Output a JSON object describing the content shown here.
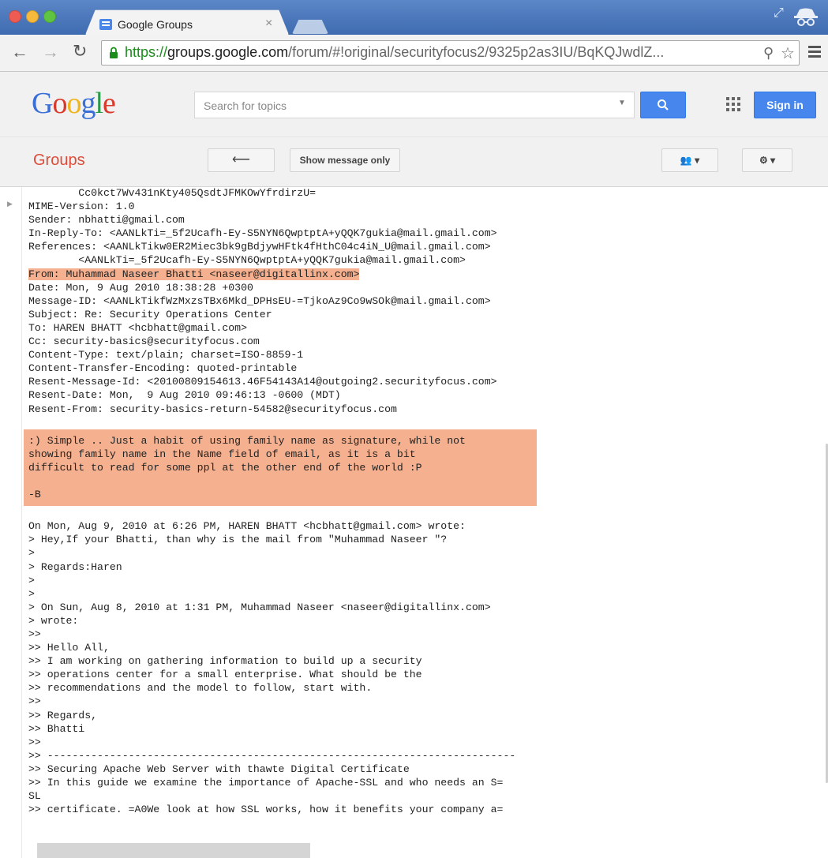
{
  "browser": {
    "tab_title": "Google Groups",
    "tab_close": "×",
    "url_scheme": "https://",
    "url_host": "groups.google.com",
    "url_path": "/forum/#!original/securityfocus2/9325p2as3IU/BqKQJwdlZ...",
    "back": "←",
    "forward": "→",
    "reload": "C"
  },
  "google_header": {
    "logo": [
      "G",
      "o",
      "o",
      "g",
      "l",
      "e"
    ],
    "search_placeholder": "Search for topics",
    "sign_in_label": "Sign in"
  },
  "groups_bar": {
    "title": "Groups",
    "back_label": "⟵",
    "show_message_only_label": "Show message only",
    "members_label": "👥 ▾",
    "settings_label": "⚙ ▾"
  },
  "message": {
    "header_lines_1": [
      "        Cc0kct7Wv431nKty405QsdtJFMKOwYfrdirzU=",
      "MIME-Version: 1.0",
      "Sender: nbhatti@gmail.com",
      "In-Reply-To: <AANLkTi=_5f2Ucafh-Ey-S5NYN6QwptptA+yQQK7gukia@mail.gmail.com>",
      "References: <AANLkTikw0ER2Miec3bk9gBdjywHFtk4fHthC04c4iN_U@mail.gmail.com>",
      "        <AANLkTi=_5f2Ucafh-Ey-S5NYN6QwptptA+yQQK7gukia@mail.gmail.com>"
    ],
    "from_line": "From: Muhammad Naseer Bhatti <naseer@digitallinx.com>",
    "header_lines_2": [
      "Date: Mon, 9 Aug 2010 18:38:28 +0300",
      "Message-ID: <AANLkTikfWzMxzsTBx6Mkd_DPHsEU-=TjkoAz9Co9wSOk@mail.gmail.com>",
      "Subject: Re: Security Operations Center",
      "To: HAREN BHATT <hcbhatt@gmail.com>",
      "Cc: security-basics@securityfocus.com",
      "Content-Type: text/plain; charset=ISO-8859-1",
      "Content-Transfer-Encoding: quoted-printable",
      "Resent-Message-Id: <20100809154613.46F54143A14@outgoing2.securityfocus.com>",
      "Resent-Date: Mon,  9 Aug 2010 09:46:13 -0600 (MDT)",
      "Resent-From: security-basics-return-54582@securityfocus.com"
    ],
    "body_highlighted": [
      ":) Simple .. Just a habit of using family name as signature, while not",
      "showing family name in the Name field of email, as it is a bit",
      "difficult to read for some ppl at the other end of the world :P",
      "",
      "-B"
    ],
    "quoted_lines": [
      "On Mon, Aug 9, 2010 at 6:26 PM, HAREN BHATT <hcbhatt@gmail.com> wrote:",
      "> Hey,If your Bhatti, than why is the mail from \"Muhammad Naseer \"?",
      ">",
      "> Regards:Haren",
      ">",
      ">",
      "> On Sun, Aug 8, 2010 at 1:31 PM, Muhammad Naseer <naseer@digitallinx.com>",
      "> wrote:",
      ">>",
      ">> Hello All,",
      ">> I am working on gathering information to build up a security",
      ">> operations center for a small enterprise. What should be the",
      ">> recommendations and the model to follow, start with.",
      ">>",
      ">> Regards,",
      ">> Bhatti",
      ">>",
      ">> ---------------------------------------------------------------------------",
      ">> Securing Apache Web Server with thawte Digital Certificate",
      ">> In this guide we examine the importance of Apache-SSL and who needs an S=",
      "SL",
      ">> certificate. =A0We look at how SSL works, how it benefits your company a="
    ]
  }
}
